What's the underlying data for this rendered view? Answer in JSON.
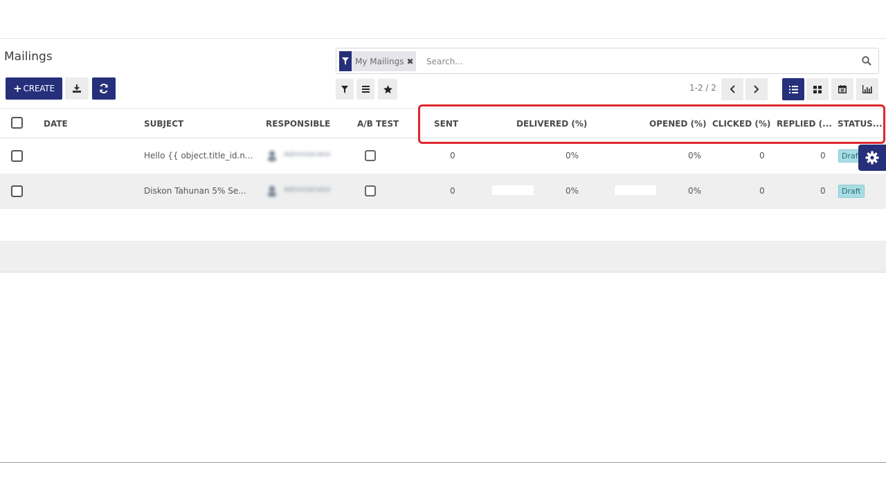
{
  "page": {
    "title": "Mailings"
  },
  "search": {
    "facet_label": "My Mailings",
    "placeholder": "Search..."
  },
  "toolbar": {
    "create_label": "CREATE"
  },
  "pager": {
    "text": "1-2 / 2"
  },
  "table": {
    "headers": {
      "date": "DATE",
      "subject": "SUBJECT",
      "responsible": "RESPONSIBLE",
      "ab_test": "A/B TEST",
      "sent": "SENT",
      "delivered": "DELIVERED (%)",
      "opened": "OPENED (%)",
      "clicked": "CLICKED (%)",
      "replied": "REPLIED (...",
      "status": "STATUS..."
    },
    "rows": [
      {
        "date": "",
        "subject": "Hello {{ object.title_id.n...",
        "responsible": "Administrator",
        "sent": "0",
        "delivered": "0%",
        "opened": "0%",
        "clicked": "0",
        "replied": "0",
        "status": "Draft"
      },
      {
        "date": "",
        "subject": "Diskon Tahunan 5% Se...",
        "responsible": "Administrator",
        "sent": "0",
        "delivered": "0%",
        "opened": "0%",
        "clicked": "0",
        "replied": "0",
        "status": "Draft"
      }
    ]
  },
  "colors": {
    "primary": "#262f7a",
    "highlight": "#e0252b",
    "badge": "#a8dde4"
  }
}
